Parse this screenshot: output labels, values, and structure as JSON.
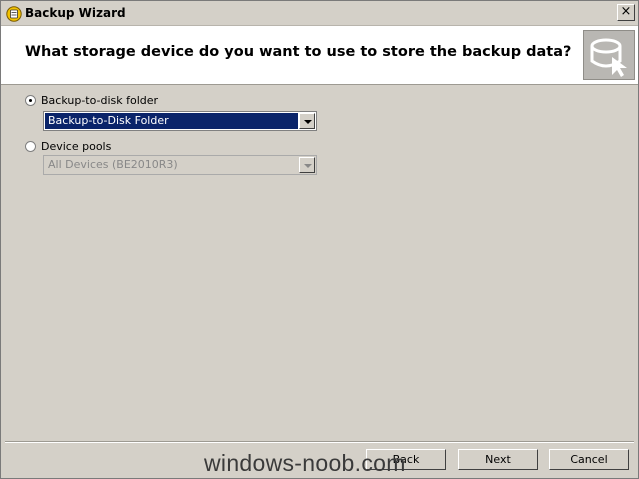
{
  "window": {
    "title": "Backup Wizard",
    "close_glyph": "×"
  },
  "header": {
    "question": "What storage device do you want to use to store the backup data?"
  },
  "options": [
    {
      "label": "Backup-to-disk folder",
      "selected": true,
      "value": "Backup-to-Disk Folder"
    },
    {
      "label": "Device pools",
      "selected": false,
      "value": "All Devices (BE2010R3)"
    }
  ],
  "buttons": {
    "back": "Back",
    "next": "Next",
    "cancel": "Cancel"
  },
  "watermark": "windows-noob.com",
  "colors": {
    "selection": "#0a246a",
    "dialog": "#d4d0c8"
  }
}
